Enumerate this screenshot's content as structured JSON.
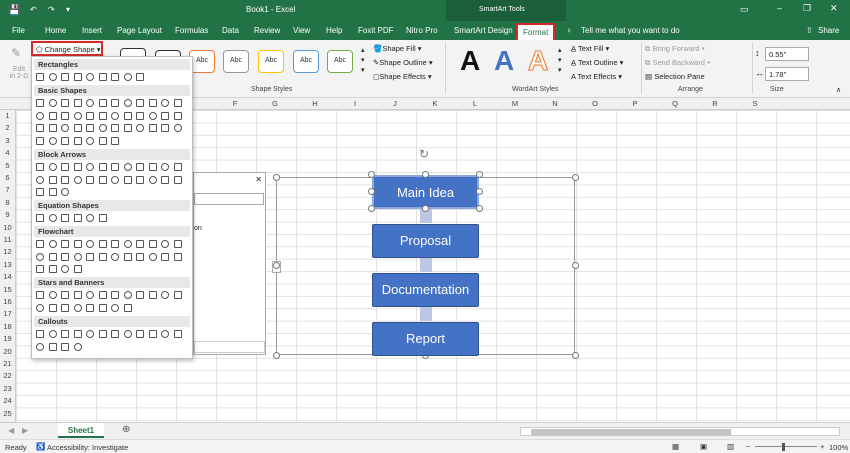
{
  "title": {
    "doc": "Book1  -  Excel",
    "context": "SmartArt Tools"
  },
  "tabs": [
    "File",
    "Home",
    "Insert",
    "Page Layout",
    "Formulas",
    "Data",
    "Review",
    "View",
    "Help",
    "Foxit PDF",
    "Nitro Pro",
    "SmartArt Design",
    "Format"
  ],
  "tell_me": "Tell me what you want to do",
  "share": "Share",
  "ribbon": {
    "edit_2d": "Edit\nin 2-D",
    "change_shape": "Change Shape",
    "abc": "Abc",
    "shape_fill": "Shape Fill",
    "shape_outline": "Shape Outline",
    "shape_effects": "Shape Effects",
    "shape_styles": "Shape Styles",
    "text_fill": "Text Fill",
    "text_outline": "Text Outline",
    "text_effects": "Text Effects",
    "wordart_styles": "WordArt Styles",
    "bring_forward": "Bring Forward",
    "send_backward": "Send Backward",
    "selection_pane": "Selection Pane",
    "arrange": "Arrange",
    "height": "0.55\"",
    "width": "1.78\"",
    "size": "Size",
    "wordart_letter": "A"
  },
  "columns": [
    "F",
    "G",
    "H",
    "I",
    "J",
    "K",
    "L",
    "M",
    "N",
    "O",
    "P",
    "Q",
    "R",
    "S"
  ],
  "rows": [
    "1",
    "2",
    "3",
    "4",
    "5",
    "6",
    "7",
    "8",
    "9",
    "10",
    "11",
    "12",
    "13",
    "14",
    "15",
    "16",
    "17",
    "18",
    "19",
    "20",
    "21",
    "22",
    "23",
    "24",
    "25"
  ],
  "dropdown": {
    "categories": [
      "Rectangles",
      "Basic Shapes",
      "Block Arrows",
      "Equation Shapes",
      "Flowchart",
      "Stars and Banners",
      "Callouts"
    ]
  },
  "panel": {
    "close": "✕",
    "partial": "on"
  },
  "smartart": {
    "nodes": [
      "Main Idea",
      "Proposal",
      "Documentation",
      "Report"
    ]
  },
  "sheet": {
    "name": "Sheet1"
  },
  "status": {
    "ready": "Ready",
    "accessibility": "Accessibility: Investigate",
    "zoom": "100%"
  },
  "colors": {
    "excel_green": "#217346",
    "node_blue": "#4472c4",
    "highlight": "#d42a2a"
  }
}
